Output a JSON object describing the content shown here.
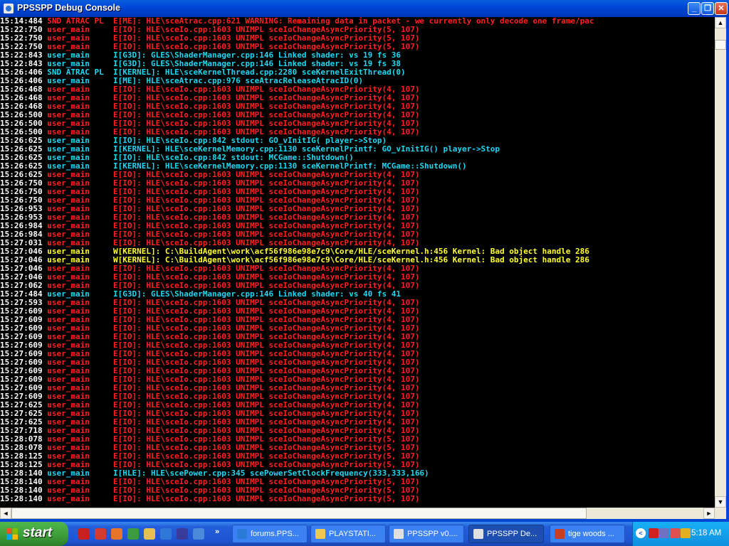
{
  "window": {
    "title": "PPSSPP Debug Console"
  },
  "titlebar_buttons": {
    "minimize": "_",
    "maximize": "❐",
    "close": "✕"
  },
  "log_lines": [
    {
      "ts": "15:14:484",
      "thread": "SND ATRAC PL",
      "level": "E",
      "msg": "E[ME]: HLE\\sceAtrac.cpp:621 WARNING: Remaining data in packet - we currently only decode one frame/pac"
    },
    {
      "ts": "15:22:750",
      "thread": "user_main",
      "level": "E",
      "msg": "E[IO]: HLE\\sceIo.cpp:1603 UNIMPL sceIoChangeAsyncPriority(5, 107)"
    },
    {
      "ts": "15:22:750",
      "thread": "user_main",
      "level": "E",
      "msg": "E[IO]: HLE\\sceIo.cpp:1603 UNIMPL sceIoChangeAsyncPriority(5, 107)"
    },
    {
      "ts": "15:22:750",
      "thread": "user_main",
      "level": "E",
      "msg": "E[IO]: HLE\\sceIo.cpp:1603 UNIMPL sceIoChangeAsyncPriority(5, 107)"
    },
    {
      "ts": "15:22:843",
      "thread": "user_main",
      "level": "I",
      "msg": "I[G3D]: GLES\\ShaderManager.cpp:146 Linked shader: vs 19 fs 36"
    },
    {
      "ts": "15:22:843",
      "thread": "user_main",
      "level": "I",
      "msg": "I[G3D]: GLES\\ShaderManager.cpp:146 Linked shader: vs 19 fs 38"
    },
    {
      "ts": "15:26:406",
      "thread": "SND ATRAC PL",
      "level": "I",
      "msg": "I[KERNEL]: HLE\\sceKernelThread.cpp:2280 sceKernelExitThread(0)"
    },
    {
      "ts": "15:26:406",
      "thread": "user_main",
      "level": "I",
      "msg": "I[ME]: HLE\\sceAtrac.cpp:976 sceAtracReleaseAtracID(0)"
    },
    {
      "ts": "15:26:468",
      "thread": "user_main",
      "level": "E",
      "msg": "E[IO]: HLE\\sceIo.cpp:1603 UNIMPL sceIoChangeAsyncPriority(4, 107)"
    },
    {
      "ts": "15:26:468",
      "thread": "user_main",
      "level": "E",
      "msg": "E[IO]: HLE\\sceIo.cpp:1603 UNIMPL sceIoChangeAsyncPriority(4, 107)"
    },
    {
      "ts": "15:26:468",
      "thread": "user_main",
      "level": "E",
      "msg": "E[IO]: HLE\\sceIo.cpp:1603 UNIMPL sceIoChangeAsyncPriority(4, 107)"
    },
    {
      "ts": "15:26:500",
      "thread": "user_main",
      "level": "E",
      "msg": "E[IO]: HLE\\sceIo.cpp:1603 UNIMPL sceIoChangeAsyncPriority(4, 107)"
    },
    {
      "ts": "15:26:500",
      "thread": "user_main",
      "level": "E",
      "msg": "E[IO]: HLE\\sceIo.cpp:1603 UNIMPL sceIoChangeAsyncPriority(4, 107)"
    },
    {
      "ts": "15:26:500",
      "thread": "user_main",
      "level": "E",
      "msg": "E[IO]: HLE\\sceIo.cpp:1603 UNIMPL sceIoChangeAsyncPriority(4, 107)"
    },
    {
      "ts": "15:26:625",
      "thread": "user_main",
      "level": "I",
      "msg": "I[IO]: HLE\\sceIo.cpp:842 stdout: GO_vInitIG( player->Stop)"
    },
    {
      "ts": "15:26:625",
      "thread": "user_main",
      "level": "I",
      "msg": "I[KERNEL]: HLE\\sceKernelMemory.cpp:1130 sceKernelPrintf: GO_vInitIG() player->Stop"
    },
    {
      "ts": "15:26:625",
      "thread": "user_main",
      "level": "I",
      "msg": "I[IO]: HLE\\sceIo.cpp:842 stdout: MCGame::Shutdown()"
    },
    {
      "ts": "15:26:625",
      "thread": "user_main",
      "level": "I",
      "msg": "I[KERNEL]: HLE\\sceKernelMemory.cpp:1130 sceKernelPrintf: MCGame::Shutdown()"
    },
    {
      "ts": "15:26:625",
      "thread": "user_main",
      "level": "E",
      "msg": "E[IO]: HLE\\sceIo.cpp:1603 UNIMPL sceIoChangeAsyncPriority(4, 107)"
    },
    {
      "ts": "15:26:750",
      "thread": "user_main",
      "level": "E",
      "msg": "E[IO]: HLE\\sceIo.cpp:1603 UNIMPL sceIoChangeAsyncPriority(4, 107)"
    },
    {
      "ts": "15:26:750",
      "thread": "user_main",
      "level": "E",
      "msg": "E[IO]: HLE\\sceIo.cpp:1603 UNIMPL sceIoChangeAsyncPriority(4, 107)"
    },
    {
      "ts": "15:26:750",
      "thread": "user_main",
      "level": "E",
      "msg": "E[IO]: HLE\\sceIo.cpp:1603 UNIMPL sceIoChangeAsyncPriority(4, 107)"
    },
    {
      "ts": "15:26:953",
      "thread": "user_main",
      "level": "E",
      "msg": "E[IO]: HLE\\sceIo.cpp:1603 UNIMPL sceIoChangeAsyncPriority(4, 107)"
    },
    {
      "ts": "15:26:953",
      "thread": "user_main",
      "level": "E",
      "msg": "E[IO]: HLE\\sceIo.cpp:1603 UNIMPL sceIoChangeAsyncPriority(4, 107)"
    },
    {
      "ts": "15:26:984",
      "thread": "user_main",
      "level": "E",
      "msg": "E[IO]: HLE\\sceIo.cpp:1603 UNIMPL sceIoChangeAsyncPriority(4, 107)"
    },
    {
      "ts": "15:26:984",
      "thread": "user_main",
      "level": "E",
      "msg": "E[IO]: HLE\\sceIo.cpp:1603 UNIMPL sceIoChangeAsyncPriority(4, 107)"
    },
    {
      "ts": "15:27:031",
      "thread": "user_main",
      "level": "E",
      "msg": "E[IO]: HLE\\sceIo.cpp:1603 UNIMPL sceIoChangeAsyncPriority(4, 107)"
    },
    {
      "ts": "15:27:046",
      "thread": "user_main",
      "level": "W",
      "msg": "W[KERNEL]: C:\\BuildAgent\\work\\acf56f986e98e7c9\\Core/HLE/sceKernel.h:456 Kernel: Bad object handle 286"
    },
    {
      "ts": "15:27:046",
      "thread": "user_main",
      "level": "W",
      "msg": "W[KERNEL]: C:\\BuildAgent\\work\\acf56f986e98e7c9\\Core/HLE/sceKernel.h:456 Kernel: Bad object handle 286"
    },
    {
      "ts": "15:27:046",
      "thread": "user_main",
      "level": "E",
      "msg": "E[IO]: HLE\\sceIo.cpp:1603 UNIMPL sceIoChangeAsyncPriority(4, 107)"
    },
    {
      "ts": "15:27:046",
      "thread": "user_main",
      "level": "E",
      "msg": "E[IO]: HLE\\sceIo.cpp:1603 UNIMPL sceIoChangeAsyncPriority(4, 107)"
    },
    {
      "ts": "15:27:062",
      "thread": "user_main",
      "level": "E",
      "msg": "E[IO]: HLE\\sceIo.cpp:1603 UNIMPL sceIoChangeAsyncPriority(4, 107)"
    },
    {
      "ts": "15:27:484",
      "thread": "user_main",
      "level": "I",
      "msg": "I[G3D]: GLES\\ShaderManager.cpp:146 Linked shader: vs 40 fs 41"
    },
    {
      "ts": "15:27:593",
      "thread": "user_main",
      "level": "E",
      "msg": "E[IO]: HLE\\sceIo.cpp:1603 UNIMPL sceIoChangeAsyncPriority(4, 107)"
    },
    {
      "ts": "15:27:609",
      "thread": "user_main",
      "level": "E",
      "msg": "E[IO]: HLE\\sceIo.cpp:1603 UNIMPL sceIoChangeAsyncPriority(4, 107)"
    },
    {
      "ts": "15:27:609",
      "thread": "user_main",
      "level": "E",
      "msg": "E[IO]: HLE\\sceIo.cpp:1603 UNIMPL sceIoChangeAsyncPriority(4, 107)"
    },
    {
      "ts": "15:27:609",
      "thread": "user_main",
      "level": "E",
      "msg": "E[IO]: HLE\\sceIo.cpp:1603 UNIMPL sceIoChangeAsyncPriority(4, 107)"
    },
    {
      "ts": "15:27:609",
      "thread": "user_main",
      "level": "E",
      "msg": "E[IO]: HLE\\sceIo.cpp:1603 UNIMPL sceIoChangeAsyncPriority(4, 107)"
    },
    {
      "ts": "15:27:609",
      "thread": "user_main",
      "level": "E",
      "msg": "E[IO]: HLE\\sceIo.cpp:1603 UNIMPL sceIoChangeAsyncPriority(4, 107)"
    },
    {
      "ts": "15:27:609",
      "thread": "user_main",
      "level": "E",
      "msg": "E[IO]: HLE\\sceIo.cpp:1603 UNIMPL sceIoChangeAsyncPriority(4, 107)"
    },
    {
      "ts": "15:27:609",
      "thread": "user_main",
      "level": "E",
      "msg": "E[IO]: HLE\\sceIo.cpp:1603 UNIMPL sceIoChangeAsyncPriority(4, 107)"
    },
    {
      "ts": "15:27:609",
      "thread": "user_main",
      "level": "E",
      "msg": "E[IO]: HLE\\sceIo.cpp:1603 UNIMPL sceIoChangeAsyncPriority(4, 107)"
    },
    {
      "ts": "15:27:609",
      "thread": "user_main",
      "level": "E",
      "msg": "E[IO]: HLE\\sceIo.cpp:1603 UNIMPL sceIoChangeAsyncPriority(4, 107)"
    },
    {
      "ts": "15:27:609",
      "thread": "user_main",
      "level": "E",
      "msg": "E[IO]: HLE\\sceIo.cpp:1603 UNIMPL sceIoChangeAsyncPriority(4, 107)"
    },
    {
      "ts": "15:27:609",
      "thread": "user_main",
      "level": "E",
      "msg": "E[IO]: HLE\\sceIo.cpp:1603 UNIMPL sceIoChangeAsyncPriority(4, 107)"
    },
    {
      "ts": "15:27:625",
      "thread": "user_main",
      "level": "E",
      "msg": "E[IO]: HLE\\sceIo.cpp:1603 UNIMPL sceIoChangeAsyncPriority(4, 107)"
    },
    {
      "ts": "15:27:625",
      "thread": "user_main",
      "level": "E",
      "msg": "E[IO]: HLE\\sceIo.cpp:1603 UNIMPL sceIoChangeAsyncPriority(4, 107)"
    },
    {
      "ts": "15:27:625",
      "thread": "user_main",
      "level": "E",
      "msg": "E[IO]: HLE\\sceIo.cpp:1603 UNIMPL sceIoChangeAsyncPriority(4, 107)"
    },
    {
      "ts": "15:27:718",
      "thread": "user_main",
      "level": "E",
      "msg": "E[IO]: HLE\\sceIo.cpp:1603 UNIMPL sceIoChangeAsyncPriority(4, 107)"
    },
    {
      "ts": "15:28:078",
      "thread": "user_main",
      "level": "E",
      "msg": "E[IO]: HLE\\sceIo.cpp:1603 UNIMPL sceIoChangeAsyncPriority(5, 107)"
    },
    {
      "ts": "15:28:078",
      "thread": "user_main",
      "level": "E",
      "msg": "E[IO]: HLE\\sceIo.cpp:1603 UNIMPL sceIoChangeAsyncPriority(5, 107)"
    },
    {
      "ts": "15:28:125",
      "thread": "user_main",
      "level": "E",
      "msg": "E[IO]: HLE\\sceIo.cpp:1603 UNIMPL sceIoChangeAsyncPriority(5, 107)"
    },
    {
      "ts": "15:28:125",
      "thread": "user_main",
      "level": "E",
      "msg": "E[IO]: HLE\\sceIo.cpp:1603 UNIMPL sceIoChangeAsyncPriority(5, 107)"
    },
    {
      "ts": "15:28:140",
      "thread": "user_main",
      "level": "I",
      "msg": "I[HLE]: HLE\\scePower.cpp:345 scePowerSetClockFrequency(333,333,166)"
    },
    {
      "ts": "15:28:140",
      "thread": "user_main",
      "level": "E",
      "msg": "E[IO]: HLE\\sceIo.cpp:1603 UNIMPL sceIoChangeAsyncPriority(5, 107)"
    },
    {
      "ts": "15:28:140",
      "thread": "user_main",
      "level": "E",
      "msg": "E[IO]: HLE\\sceIo.cpp:1603 UNIMPL sceIoChangeAsyncPriority(5, 107)"
    },
    {
      "ts": "15:28:140",
      "thread": "user_main",
      "level": "E",
      "msg": "E[IO]: HLE\\sceIo.cpp:1603 UNIMPL sceIoChangeAsyncPriority(5, 107)"
    }
  ],
  "level_colors": {
    "E": "#ff2020",
    "I": "#20d6f0",
    "W": "#ffff30"
  },
  "scrollbars": {
    "up_arrow": "▲",
    "down_arrow": "▼",
    "left_arrow": "◄",
    "right_arrow": "►"
  },
  "taskbar": {
    "start_label": "start",
    "quicklaunch_icons": [
      "adobe-reader-icon",
      "gmail-icon",
      "firefox-icon",
      "chrome-icon",
      "folder-icon",
      "ie-icon",
      "media-player-icon",
      "messenger-icon"
    ],
    "chevron": "»",
    "tasks": [
      {
        "label": "forums.PPS...",
        "icon": "ie-icon",
        "active": false
      },
      {
        "label": "PLAYSTATI...",
        "icon": "folder-icon",
        "active": false
      },
      {
        "label": "PPSSPP v0....",
        "icon": "ppsspp-icon",
        "active": false
      },
      {
        "label": "PPSSPP De...",
        "icon": "ppsspp-icon",
        "active": true
      },
      {
        "label": "tige woods ...",
        "icon": "game-icon",
        "active": false
      }
    ],
    "tray_arrow": "<",
    "tray_icons": [
      "flag-icon",
      "network-icon",
      "volume-icon",
      "security-icon"
    ],
    "clock": "5:18 AM"
  }
}
